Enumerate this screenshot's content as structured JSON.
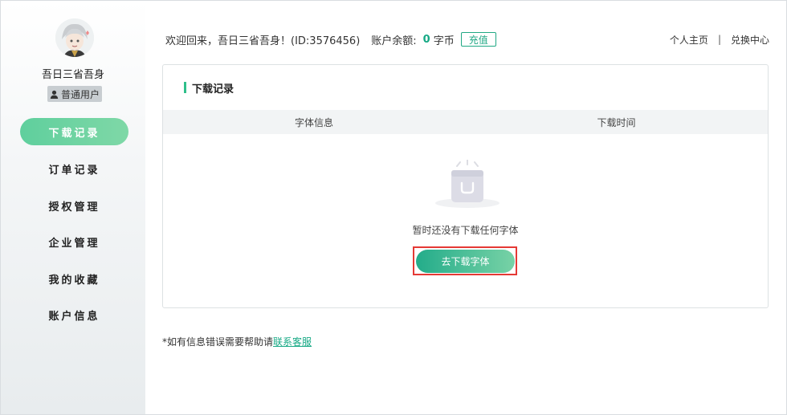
{
  "user": {
    "name": "吾日三省吾身",
    "badge": "普通用户"
  },
  "nav": {
    "items": [
      {
        "label": "下载记录",
        "active": true
      },
      {
        "label": "订单记录",
        "active": false
      },
      {
        "label": "授权管理",
        "active": false
      },
      {
        "label": "企业管理",
        "active": false
      },
      {
        "label": "我的收藏",
        "active": false
      },
      {
        "label": "账户信息",
        "active": false
      }
    ]
  },
  "header": {
    "welcome": "欢迎回来，吾日三省吾身！(ID:3576456)",
    "balance_label": "账户余额:",
    "balance_value": "0",
    "balance_unit": "字币",
    "recharge_label": "充值",
    "links": {
      "home": "个人主页",
      "separator": "|",
      "exchange": "兑换中心"
    }
  },
  "panel": {
    "title": "下载记录",
    "columns": [
      "字体信息",
      "下载时间"
    ],
    "empty_text": "暂时还没有下载任何字体",
    "download_button": "去下载字体"
  },
  "footer": {
    "note": "*如有信息错误需要帮助请",
    "link": "联系客服"
  },
  "colors": {
    "accent": "#20a884",
    "nav_active_start": "#5fcf9d",
    "highlight_border": "#e53935"
  }
}
